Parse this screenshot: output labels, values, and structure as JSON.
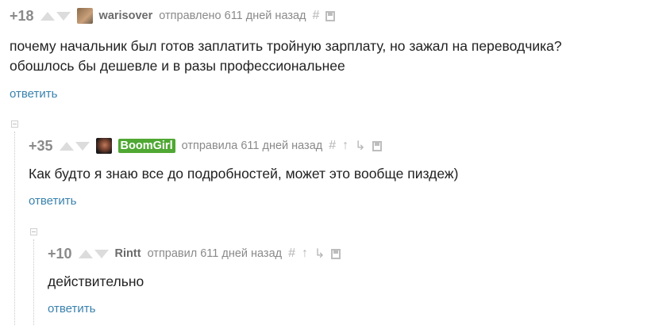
{
  "comments": [
    {
      "rating": "+18",
      "username": "warisover",
      "meta": "отправлено 611 дней назад",
      "text_lines": [
        "почему начальник был готов заплатить тройную зарплату, но зажал на переводчика?",
        "обошлось бы дешевле и в разы профессиональнее"
      ],
      "reply": "ответить"
    },
    {
      "rating": "+35",
      "username": "BoomGirl",
      "meta": "отправила 611 дней назад",
      "text_lines": [
        "Как будто я знаю все до подробностей, может это вообще пиздеж)"
      ],
      "reply": "ответить"
    },
    {
      "rating": "+10",
      "username": "Rintt",
      "meta": "отправил 611 дней назад",
      "text_lines": [
        "действительно"
      ],
      "reply": "ответить"
    }
  ],
  "icons": {
    "hash": "#",
    "up_tree": "↑",
    "branch": "↳",
    "save": "save-icon"
  },
  "colors": {
    "reply_link": "#3a82ad",
    "username_highlight": "#4fa833",
    "meta_gray": "#8a8a8a"
  }
}
